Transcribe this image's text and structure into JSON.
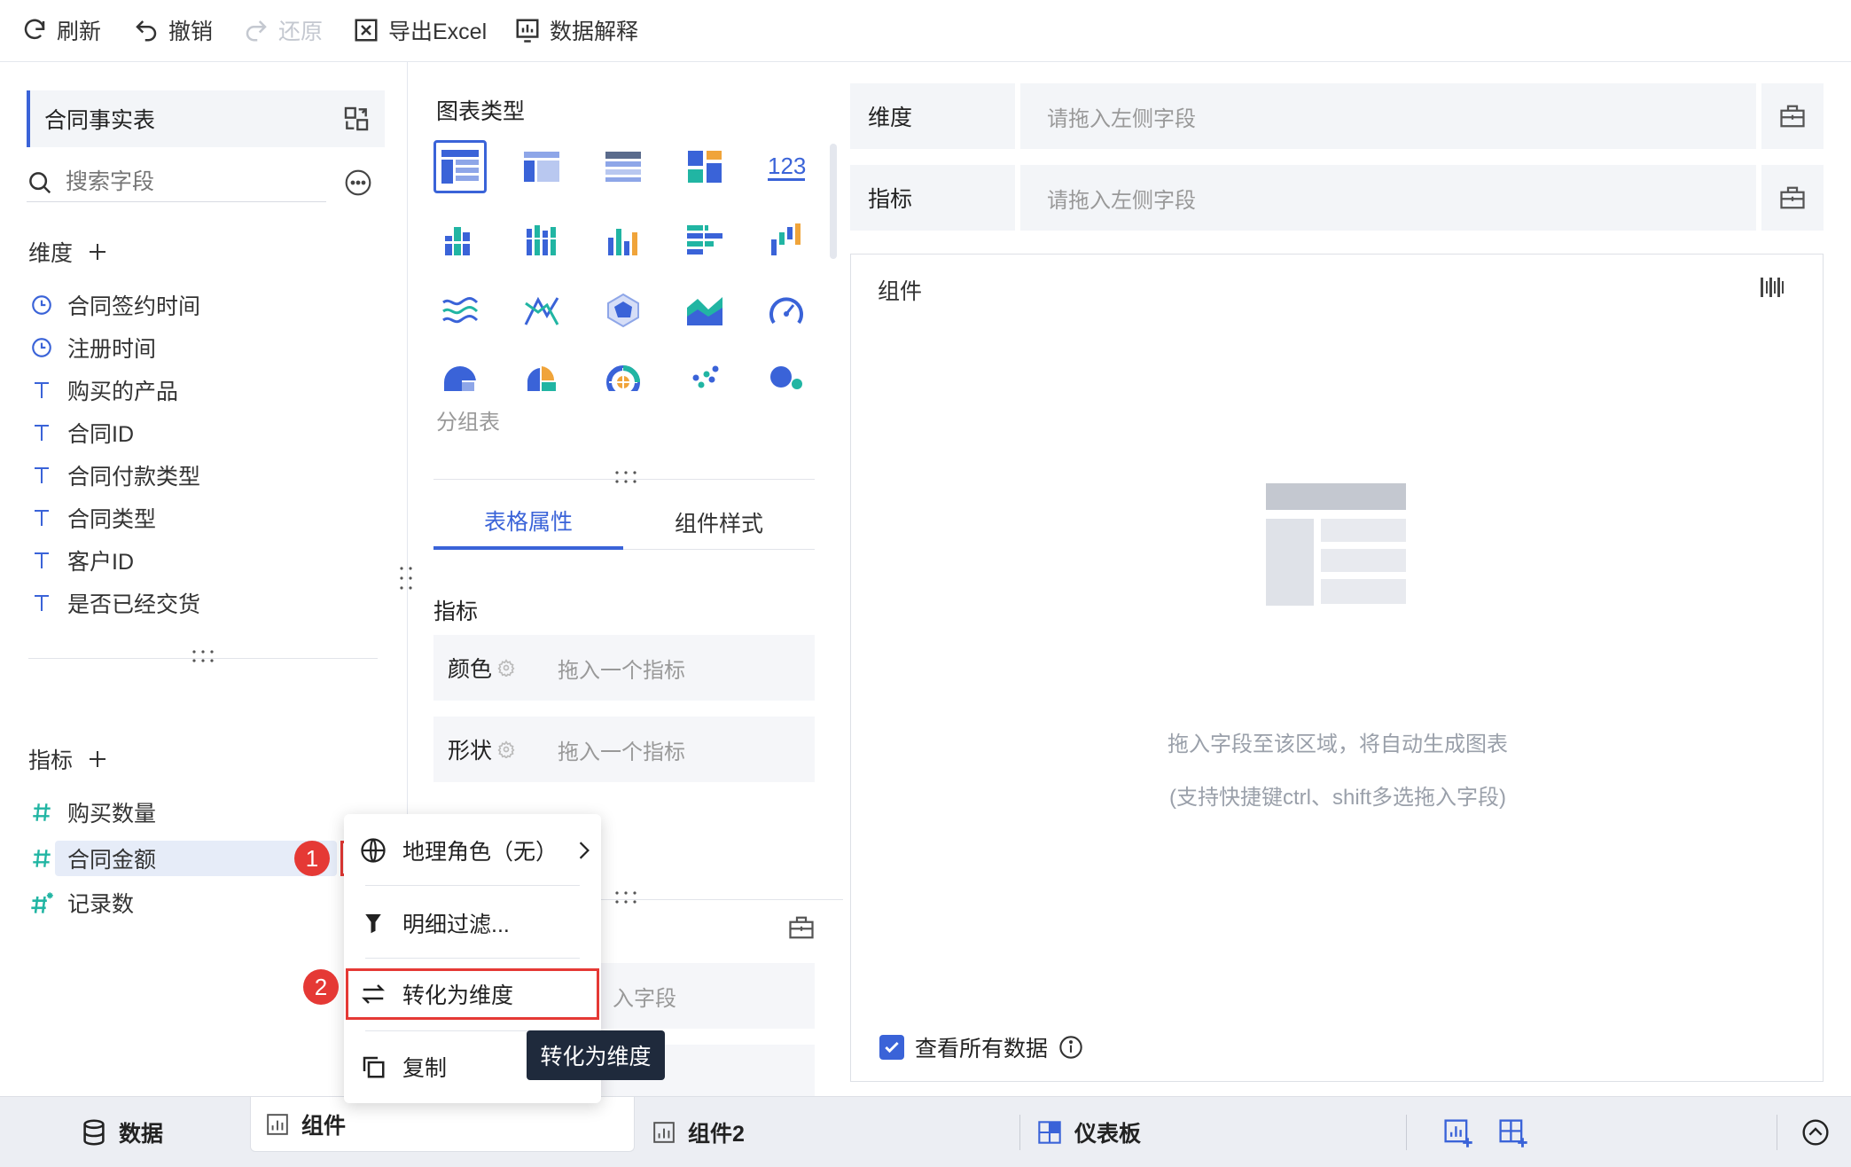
{
  "toolbar": {
    "refresh": "刷新",
    "undo": "撤销",
    "redo": "还原",
    "export": "导出Excel",
    "explain": "数据解释"
  },
  "left": {
    "table_name": "合同事实表",
    "search_placeholder": "搜索字段",
    "dimension_title": "维度",
    "dimension_fields": [
      {
        "icon": "clock-icon",
        "label": "合同签约时间"
      },
      {
        "icon": "clock-icon",
        "label": "注册时间"
      },
      {
        "icon": "text-icon",
        "label": "购买的产品"
      },
      {
        "icon": "text-icon",
        "label": "合同ID"
      },
      {
        "icon": "text-icon",
        "label": "合同付款类型"
      },
      {
        "icon": "text-icon",
        "label": "合同类型"
      },
      {
        "icon": "text-icon",
        "label": "客户ID"
      },
      {
        "icon": "text-icon",
        "label": "是否已经交货"
      }
    ],
    "metric_title": "指标",
    "metric_fields": [
      {
        "icon": "hash-icon",
        "label": "购买数量"
      },
      {
        "icon": "hash-icon",
        "label": "合同金额"
      },
      {
        "icon": "hash-star-icon",
        "label": "记录数"
      }
    ]
  },
  "middle": {
    "chart_type_title": "图表类型",
    "chart_type_selected_name": "分组表",
    "tabs": [
      "表格属性",
      "组件样式"
    ],
    "metric_label": "指标",
    "color_label": "颜色",
    "color_placeholder": "拖入一个指标",
    "shape_label": "形状",
    "shape_placeholder": "拖入一个指标",
    "partial_drop_text": "入字段"
  },
  "right": {
    "dimension_label": "维度",
    "dimension_placeholder": "请拖入左侧字段",
    "metric_label": "指标",
    "metric_placeholder": "请拖入左侧字段",
    "component_title": "组件",
    "empty_hint": "拖入字段至该区域，将自动生成图表",
    "empty_hint_sub": "(支持快捷键ctrl、shift多选拖入字段)",
    "view_all_label": "查看所有数据"
  },
  "context_menu": {
    "items": [
      "地理角色（无）",
      "明细过滤...",
      "转化为维度",
      "复制"
    ],
    "tooltip": "转化为维度",
    "badge_1": "1",
    "badge_2": "2"
  },
  "bottom": {
    "data_tab": "数据",
    "component_tab": "组件",
    "component2_tab": "组件2",
    "dashboard_tab": "仪表板"
  },
  "colors": {
    "accent": "#3a63d8",
    "highlight_red": "#e53935",
    "teal": "#21b5a3",
    "tooltip_bg": "#1f2a3c"
  }
}
